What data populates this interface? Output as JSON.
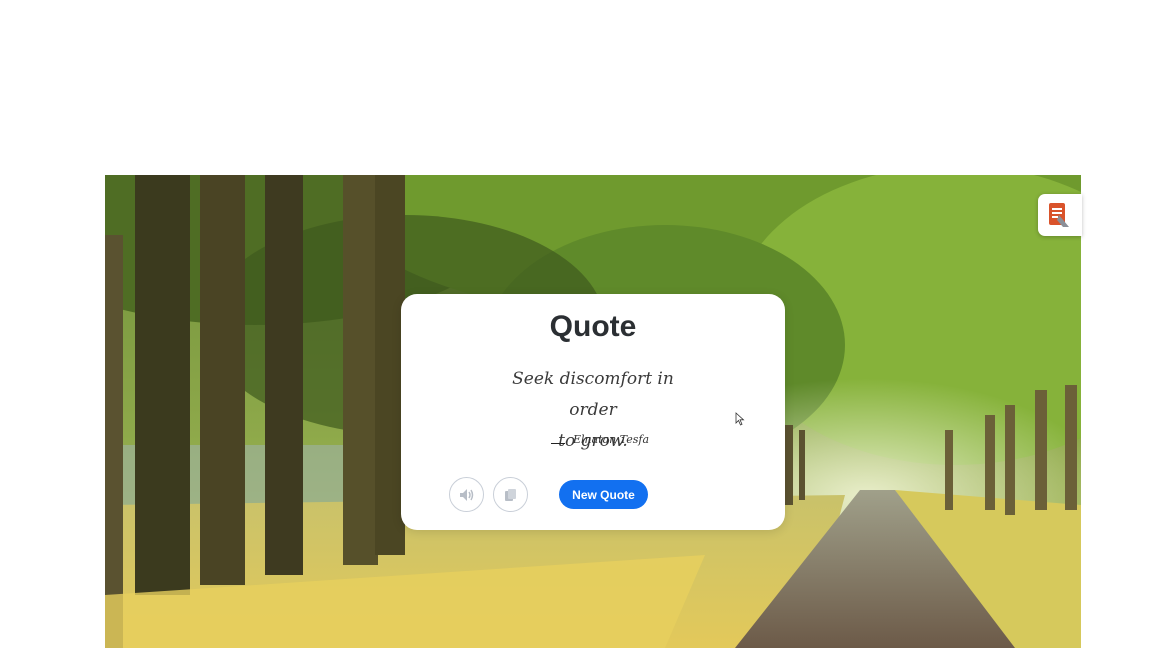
{
  "card": {
    "title": "Quote",
    "quote_line1": "Seek discomfort in order",
    "quote_line2": "to grow.",
    "author": "Elnatan Tesfa"
  },
  "buttons": {
    "speak_icon": "speaker-icon",
    "copy_icon": "copy-icon",
    "new_quote_label": "New Quote"
  },
  "extension_badge": {
    "icon": "reader-extension-icon"
  },
  "colors": {
    "accent": "#1270f0",
    "card_background": "#ffffff",
    "title_text": "#2b2f33"
  }
}
